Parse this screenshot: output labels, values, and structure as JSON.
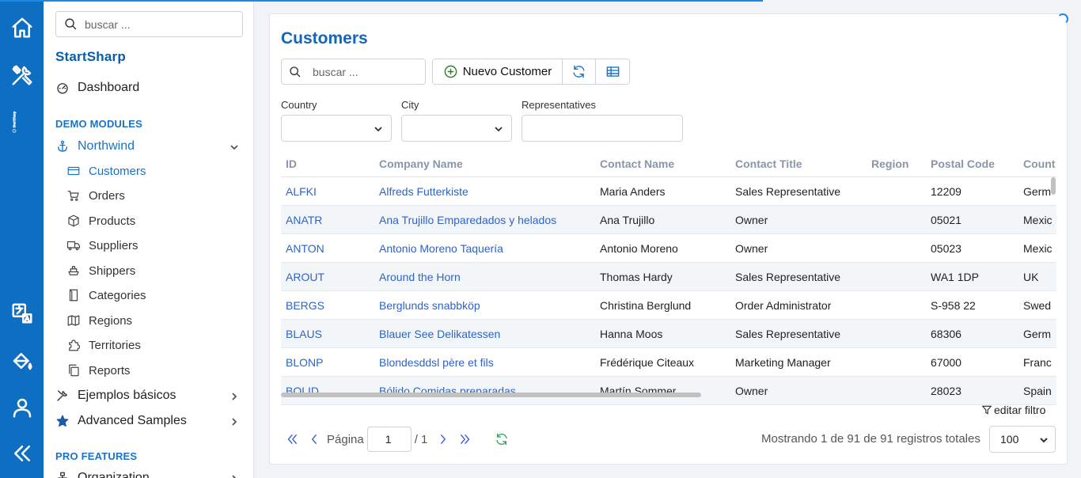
{
  "rail": {
    "brand_text": "StartSharp",
    "icons": [
      "home-icon",
      "tools-icon",
      "translate-icon",
      "paint-bucket-icon",
      "user-icon",
      "collapse-icon"
    ]
  },
  "sidebar": {
    "search_placeholder": "buscar ...",
    "brand": "StartSharp",
    "dashboard": "Dashboard",
    "section_demo": "DEMO MODULES",
    "northwind": "Northwind",
    "items": [
      {
        "label": "Customers",
        "icon": "card-icon",
        "active": true
      },
      {
        "label": "Orders",
        "icon": "cart-icon"
      },
      {
        "label": "Products",
        "icon": "box-icon"
      },
      {
        "label": "Suppliers",
        "icon": "truck-icon"
      },
      {
        "label": "Shippers",
        "icon": "ship-icon"
      },
      {
        "label": "Categories",
        "icon": "folder-icon"
      },
      {
        "label": "Regions",
        "icon": "map-icon"
      },
      {
        "label": "Territories",
        "icon": "puzzle-icon"
      },
      {
        "label": "Reports",
        "icon": "copy-icon"
      }
    ],
    "basic_samples": "Ejemplos básicos",
    "advanced_samples": "Advanced Samples",
    "section_pro": "PRO FEATURES",
    "organization": "Organization"
  },
  "main": {
    "title": "Customers",
    "search_placeholder": "buscar ...",
    "new_button": "Nuevo Customer",
    "filters": {
      "country_label": "Country",
      "city_label": "City",
      "representatives_label": "Representatives"
    },
    "columns": [
      "ID",
      "Company Name",
      "Contact Name",
      "Contact Title",
      "Region",
      "Postal Code",
      "Count"
    ],
    "rows": [
      [
        "ALFKI",
        "Alfreds Futterkiste",
        "Maria Anders",
        "Sales Representative",
        "",
        "12209",
        "Germ"
      ],
      [
        "ANATR",
        "Ana Trujillo Emparedados y helados",
        "Ana Trujillo",
        "Owner",
        "",
        "05021",
        "Mexic"
      ],
      [
        "ANTON",
        "Antonio Moreno Taquería",
        "Antonio Moreno",
        "Owner",
        "",
        "05023",
        "Mexic"
      ],
      [
        "AROUT",
        "Around the Horn",
        "Thomas Hardy",
        "Sales Representative",
        "",
        "WA1 1DP",
        "UK"
      ],
      [
        "BERGS",
        "Berglunds snabbköp",
        "Christina Berglund",
        "Order Administrator",
        "",
        "S-958 22",
        "Swed"
      ],
      [
        "BLAUS",
        "Blauer See Delikatessen",
        "Hanna Moos",
        "Sales Representative",
        "",
        "68306",
        "Germ"
      ],
      [
        "BLONP",
        "Blondesddsl père et fils",
        "Frédérique Citeaux",
        "Marketing Manager",
        "",
        "67000",
        "Franc"
      ],
      [
        "BOLID",
        "Bólido Comidas preparadas",
        "Martín Sommer",
        "Owner",
        "",
        "28023",
        "Spain"
      ]
    ],
    "edit_filter": "editar filtro",
    "pager": {
      "page_label": "Página",
      "page_value": "1",
      "page_total": "/ 1",
      "summary": "Mostrando 1 de 91 de 91 registros totales",
      "page_size": "100"
    }
  }
}
